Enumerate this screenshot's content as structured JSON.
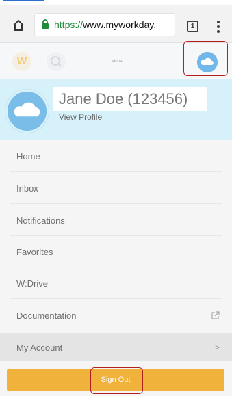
{
  "browser": {
    "url_scheme": "https://",
    "url_domain": "www.myworkday.",
    "tab_count": "1"
  },
  "app": {
    "tenant_name": "Virtua"
  },
  "profile": {
    "name": "Jane Doe (123456)",
    "link": "View Profile"
  },
  "menu": {
    "items": [
      {
        "label": "Home"
      },
      {
        "label": "Inbox"
      },
      {
        "label": "Notifications"
      },
      {
        "label": "Favorites"
      },
      {
        "label": "W:Drive"
      },
      {
        "label": "Documentation"
      }
    ],
    "account_label": "My Account",
    "chevron": ">",
    "signout_label": "Sign Out"
  },
  "colors": {
    "accent": "#f0b23b",
    "profile_bg": "#d6f1f9",
    "avatar": "#79bde8",
    "highlight": "#b11f1f"
  },
  "icons": [
    "home-icon",
    "lock-icon",
    "tab-switcher-icon",
    "menu-icon",
    "workday-logo-icon",
    "search-icon",
    "cloud-avatar-icon",
    "external-link-icon",
    "chevron-right-icon"
  ]
}
